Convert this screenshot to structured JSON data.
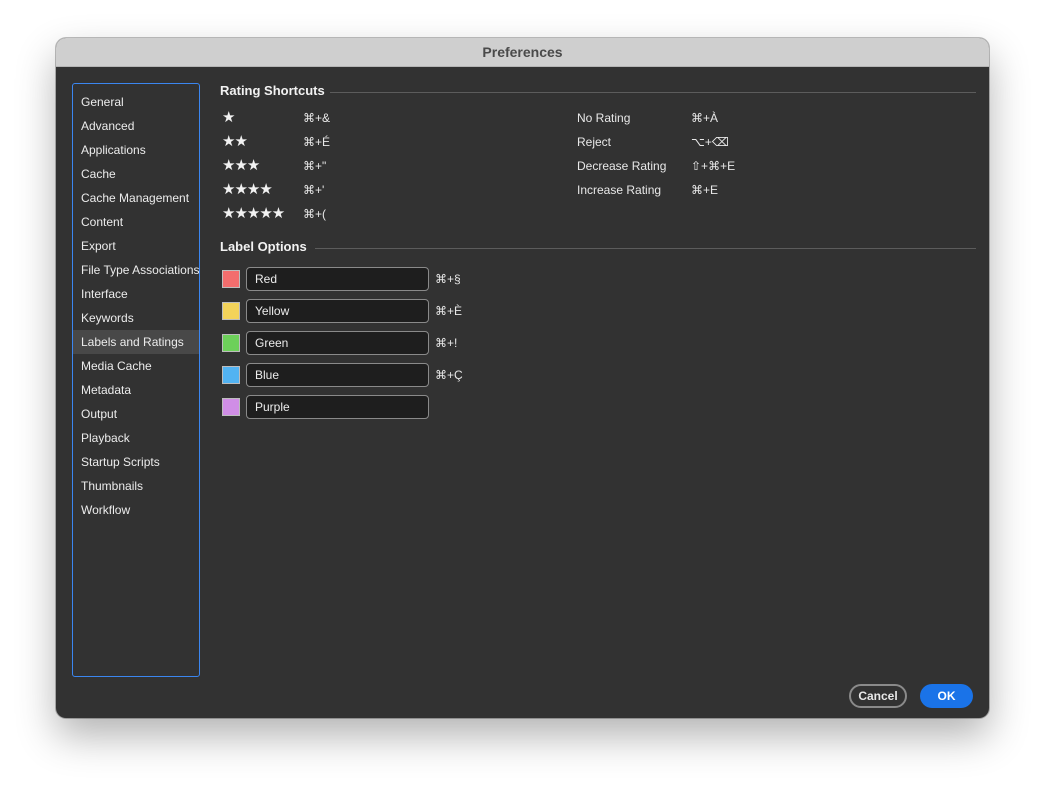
{
  "window": {
    "title": "Preferences"
  },
  "sidebar": {
    "items": [
      {
        "label": "General"
      },
      {
        "label": "Advanced"
      },
      {
        "label": "Applications"
      },
      {
        "label": "Cache"
      },
      {
        "label": "Cache Management"
      },
      {
        "label": "Content"
      },
      {
        "label": "Export"
      },
      {
        "label": "File Type Associations"
      },
      {
        "label": "Interface"
      },
      {
        "label": "Keywords"
      },
      {
        "label": "Labels and Ratings"
      },
      {
        "label": "Media Cache"
      },
      {
        "label": "Metadata"
      },
      {
        "label": "Output"
      },
      {
        "label": "Playback"
      },
      {
        "label": "Startup Scripts"
      },
      {
        "label": "Thumbnails"
      },
      {
        "label": "Workflow"
      }
    ],
    "selected": "Labels and Ratings"
  },
  "rating_shortcuts": {
    "title": "Rating Shortcuts",
    "stars": [
      {
        "stars": "★",
        "shortcut": "⌘+&"
      },
      {
        "stars": "★★",
        "shortcut": "⌘+É"
      },
      {
        "stars": "★★★",
        "shortcut": "⌘+\""
      },
      {
        "stars": "★★★★",
        "shortcut": "⌘+'"
      },
      {
        "stars": "★★★★★",
        "shortcut": "⌘+("
      }
    ],
    "actions": [
      {
        "label": "No Rating",
        "shortcut": "⌘+À"
      },
      {
        "label": "Reject",
        "shortcut": "⌥+⌫"
      },
      {
        "label": "Decrease Rating",
        "shortcut": "⇧+⌘+E"
      },
      {
        "label": "Increase Rating",
        "shortcut": "⌘+E"
      }
    ]
  },
  "label_options": {
    "title": "Label Options",
    "labels": [
      {
        "name": "Red",
        "color": "#f26d6d",
        "shortcut": "⌘+§"
      },
      {
        "name": "Yellow",
        "color": "#f3d35a",
        "shortcut": "⌘+È"
      },
      {
        "name": "Green",
        "color": "#6dd05a",
        "shortcut": "⌘+!"
      },
      {
        "name": "Blue",
        "color": "#52b3f2",
        "shortcut": "⌘+Ç"
      },
      {
        "name": "Purple",
        "color": "#d08ee6",
        "shortcut": ""
      }
    ]
  },
  "buttons": {
    "cancel": "Cancel",
    "ok": "OK"
  }
}
